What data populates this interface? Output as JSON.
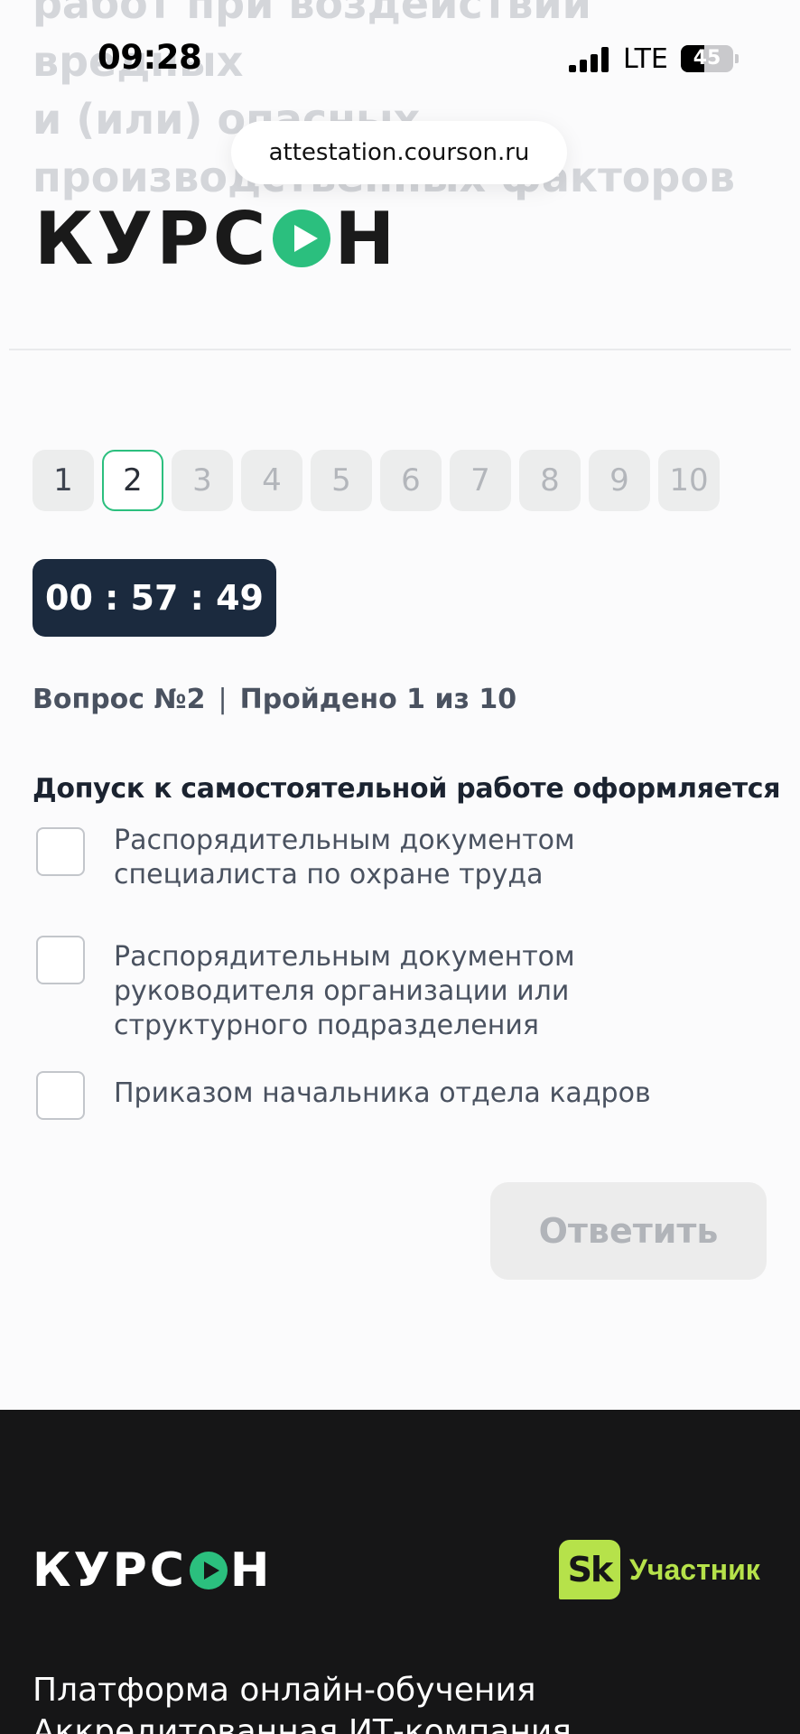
{
  "background_heading": {
    "line1": "работ при воздействии вредных",
    "line2": "и (или) опасных",
    "line3": "производственных факторов"
  },
  "status_bar": {
    "time": "09:28",
    "network": "LTE",
    "battery": "45",
    "battery_level": 0.45
  },
  "browser": {
    "url": "attestation.courson.ru"
  },
  "header": {
    "logo_left": "КУРС",
    "logo_right": "Н"
  },
  "pager": {
    "items": [
      "1",
      "2",
      "3",
      "4",
      "5",
      "6",
      "7",
      "8",
      "9",
      "10"
    ],
    "current": "2",
    "completed": [
      "1"
    ]
  },
  "timer": {
    "value": "00 : 57 : 49"
  },
  "progress": {
    "question": "Вопрос №2",
    "separator": "|",
    "passed": "Пройдено 1 из 10"
  },
  "question": {
    "title": "Допуск к самостоятельной работе оформляется",
    "options": [
      "Распорядительным документом специалиста по охране труда",
      "Распорядительным документом руководителя организации или структурного подразделения",
      "Приказом начальника отдела кадров"
    ]
  },
  "actions": {
    "answer_label": "Ответить"
  },
  "footer": {
    "logo_left": "КУРС",
    "logo_right": "Н",
    "badge_icon_text": "Sk",
    "badge_label": "Участник",
    "line1": "Платформа онлайн-обучения",
    "line2": "Аккредитованная ИТ-компания"
  },
  "colors": {
    "accent": "#2bbf7e",
    "timer_bg": "#1b2a3e",
    "footer_bg": "#161617",
    "sk_green": "#b6e24a"
  }
}
